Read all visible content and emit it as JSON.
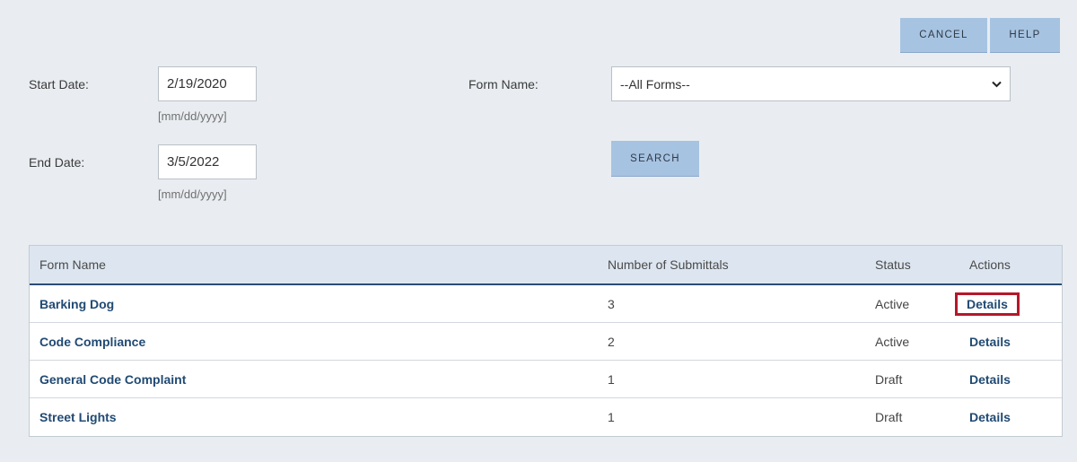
{
  "toolbar": {
    "cancel_label": "CANCEL",
    "help_label": "HELP"
  },
  "filters": {
    "start_date_label": "Start Date:",
    "start_date_value": "2/19/2020",
    "start_date_hint": "[mm/dd/yyyy]",
    "end_date_label": "End Date:",
    "end_date_value": "3/5/2022",
    "end_date_hint": "[mm/dd/yyyy]",
    "form_name_label": "Form Name:",
    "form_name_selected": "--All Forms--",
    "search_label": "SEARCH"
  },
  "table": {
    "headers": [
      "Form Name",
      "Number of Submittals",
      "Status",
      "Actions"
    ],
    "rows": [
      {
        "form_name": "Barking Dog",
        "submittals": "3",
        "status": "Active",
        "action": "Details"
      },
      {
        "form_name": "Code Compliance",
        "submittals": "2",
        "status": "Active",
        "action": "Details"
      },
      {
        "form_name": "General Code Complaint",
        "submittals": "1",
        "status": "Draft",
        "action": "Details"
      },
      {
        "form_name": "Street Lights",
        "submittals": "1",
        "status": "Draft",
        "action": "Details"
      }
    ]
  },
  "colors": {
    "accent": "#a7c3e2",
    "link": "#214a73",
    "highlight": "#b5172a"
  }
}
